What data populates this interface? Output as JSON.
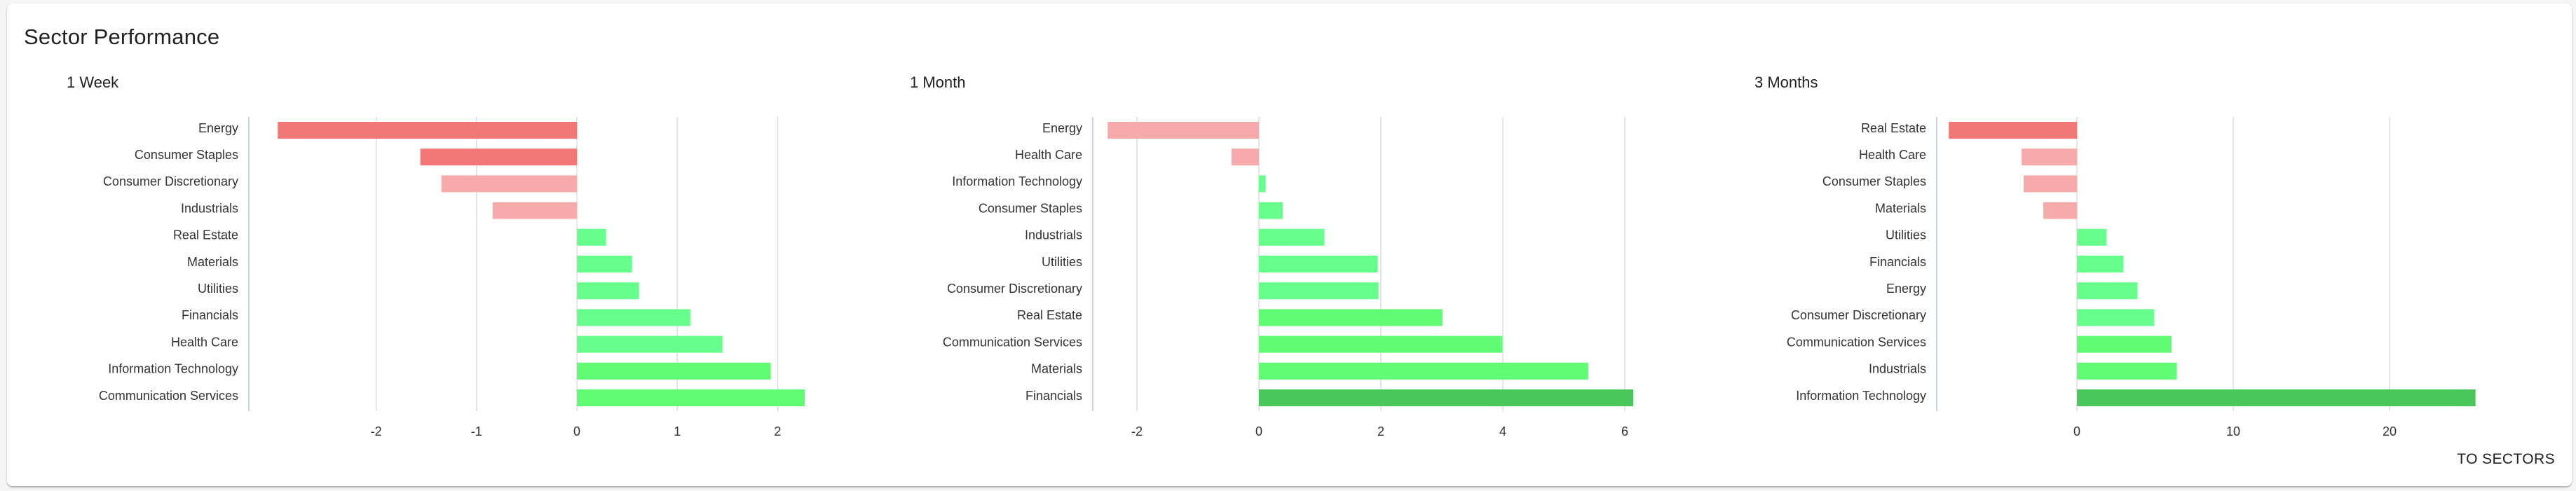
{
  "card": {
    "title": "Sector Performance",
    "button_label": "TO SECTORS"
  },
  "colors": {
    "strong_negative": "#f47777",
    "negative": "#f7aaaa",
    "positive": "#66ff8c",
    "strong_positive": "#5ffb72",
    "top_positive": "#49c75b",
    "gridline": "#dddddd",
    "axis_line": "#c9d3e8"
  },
  "chart_data": [
    {
      "type": "bar",
      "orientation": "horizontal",
      "title": "1 Week",
      "xlabel": "",
      "ylabel": "",
      "xlim": [
        -3,
        2.3
      ],
      "ticks": [
        -2,
        -1,
        0,
        1,
        2
      ],
      "tick_labels": [
        "-2",
        "-1",
        "0",
        "1",
        "2"
      ],
      "grid": true,
      "categories": [
        "Energy",
        "Consumer Staples",
        "Consumer Discretionary",
        "Industrials",
        "Real Estate",
        "Materials",
        "Utilities",
        "Financials",
        "Health Care",
        "Information Technology",
        "Communication Services"
      ],
      "values": [
        -2.98,
        -1.56,
        -1.35,
        -0.84,
        0.29,
        0.55,
        0.62,
        1.13,
        1.45,
        1.93,
        2.27
      ],
      "color_classes": [
        "strong_negative",
        "strong_negative",
        "negative",
        "negative",
        "positive",
        "positive",
        "positive",
        "positive",
        "positive",
        "strong_positive",
        "strong_positive"
      ]
    },
    {
      "type": "bar",
      "orientation": "horizontal",
      "title": "1 Month",
      "xlabel": "",
      "ylabel": "",
      "xlim": [
        -2.7,
        6.2
      ],
      "ticks": [
        -2,
        0,
        2,
        4,
        6
      ],
      "tick_labels": [
        "-2",
        "0",
        "2",
        "4",
        "6"
      ],
      "grid": true,
      "categories": [
        "Energy",
        "Health Care",
        "Information Technology",
        "Consumer Staples",
        "Industrials",
        "Utilities",
        "Consumer Discretionary",
        "Real Estate",
        "Communication Services",
        "Materials",
        "Financials"
      ],
      "values": [
        -2.48,
        -0.45,
        0.11,
        0.39,
        1.07,
        1.95,
        1.96,
        3.01,
        3.99,
        5.4,
        6.14
      ],
      "color_classes": [
        "negative",
        "negative",
        "positive",
        "positive",
        "positive",
        "positive",
        "positive",
        "strong_positive",
        "strong_positive",
        "strong_positive",
        "top_positive"
      ]
    },
    {
      "type": "bar",
      "orientation": "horizontal",
      "title": "3 Months",
      "xlabel": "",
      "ylabel": "",
      "xlim": [
        -9,
        27
      ],
      "ticks": [
        0,
        10,
        20
      ],
      "tick_labels": [
        "0",
        "10",
        "20"
      ],
      "grid": true,
      "categories": [
        "Real Estate",
        "Health Care",
        "Consumer Staples",
        "Materials",
        "Utilities",
        "Financials",
        "Energy",
        "Consumer Discretionary",
        "Communication Services",
        "Industrials",
        "Information Technology"
      ],
      "values": [
        -8.2,
        -3.54,
        -3.41,
        -2.15,
        1.88,
        2.96,
        3.86,
        4.93,
        6.05,
        6.37,
        25.5
      ],
      "color_classes": [
        "strong_negative",
        "negative",
        "negative",
        "negative",
        "positive",
        "positive",
        "positive",
        "positive",
        "strong_positive",
        "strong_positive",
        "top_positive"
      ]
    }
  ]
}
